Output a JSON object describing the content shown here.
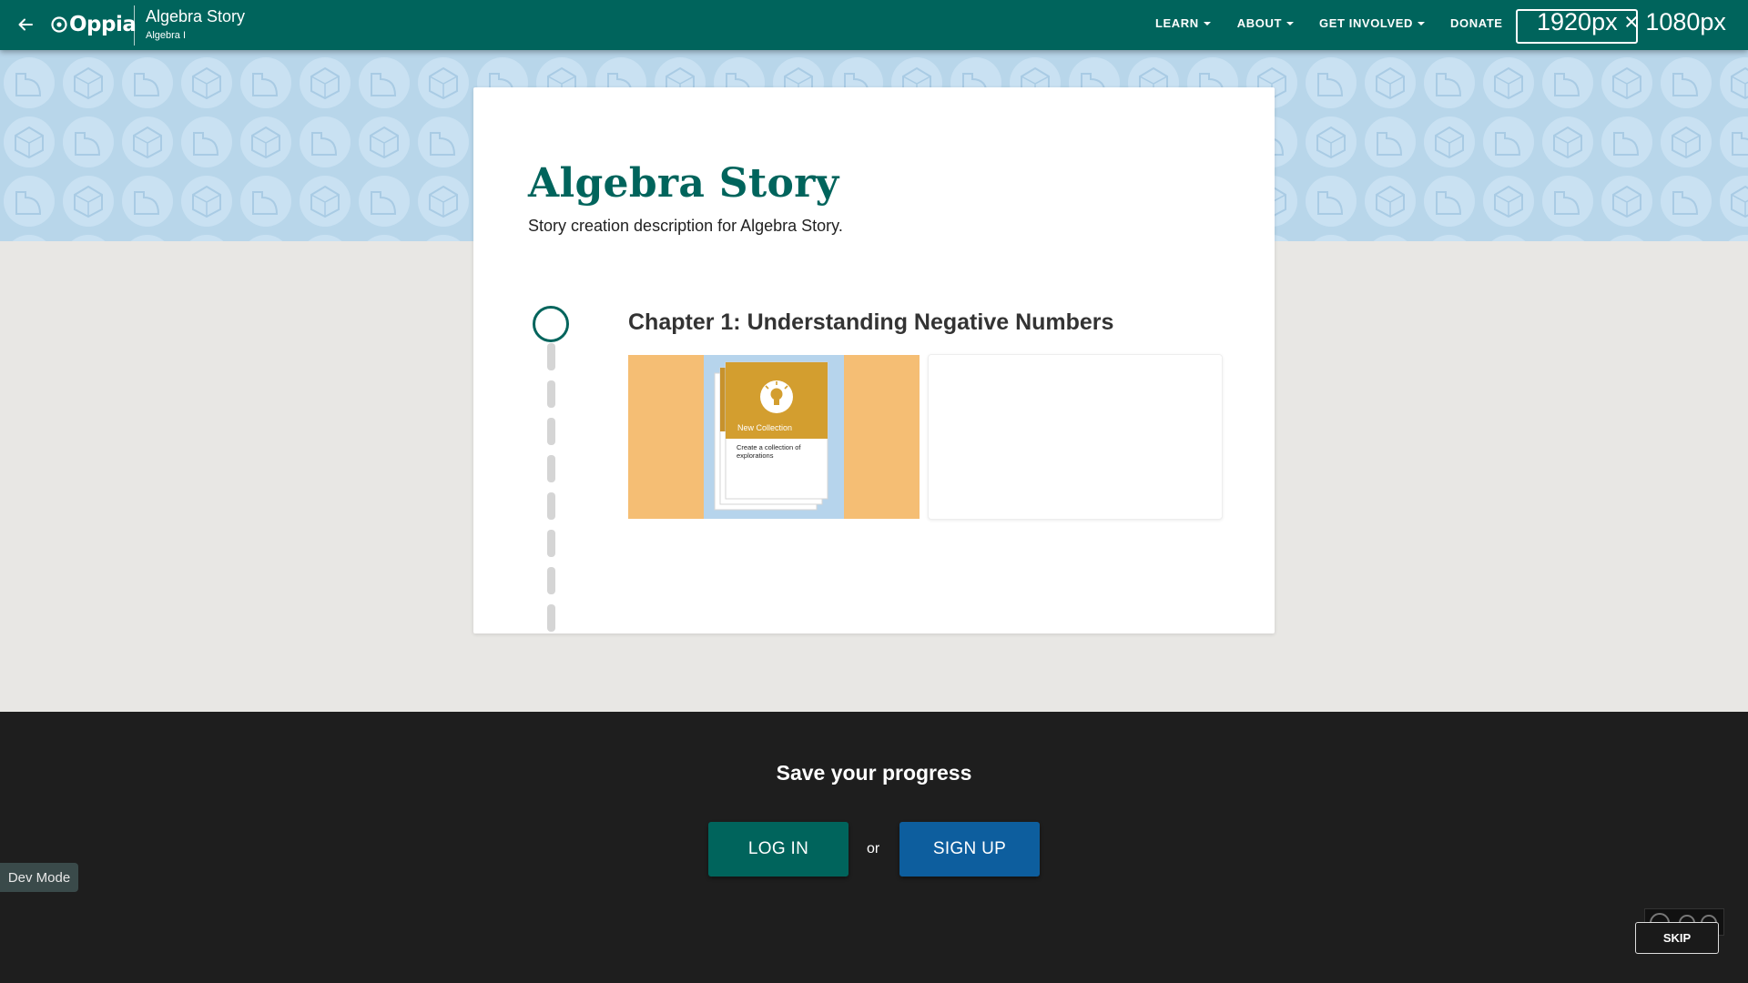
{
  "nav": {
    "logo_text": "Oppia",
    "story_title": "Algebra Story",
    "topic_name": "Algebra I",
    "links": [
      {
        "label": "LEARN",
        "has_caret": true
      },
      {
        "label": "ABOUT",
        "has_caret": true
      },
      {
        "label": "GET INVOLVED",
        "has_caret": true
      },
      {
        "label": "DONATE",
        "has_caret": false
      }
    ],
    "dimension_readout": "1920px × 1080px"
  },
  "story": {
    "title": "Algebra Story",
    "description": "Story creation description for Algebra Story.",
    "chapters": [
      {
        "title": "Chapter 1: Understanding Negative Numbers",
        "thumbnail": {
          "card_title": "New Collection",
          "card_text": "Create a collection of explorations"
        }
      }
    ]
  },
  "footer": {
    "heading": "Save your progress",
    "login_label": "LOG IN",
    "or_label": "or",
    "signup_label": "SIGN UP"
  },
  "dev_mode_label": "Dev Mode",
  "skip_label": "SKIP",
  "colors": {
    "brand_teal": "#00645c",
    "signup_blue": "#0d5e9e",
    "banner_blue": "#b8d6ea",
    "thumbnail_orange": "#f5be74",
    "thumbnail_gold": "#d39e2f",
    "footer_dark": "#1e1e1e"
  }
}
